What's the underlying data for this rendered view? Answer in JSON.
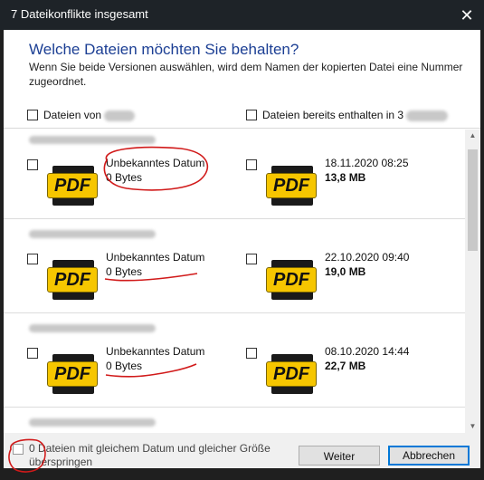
{
  "window": {
    "title": "7 Dateikonflikte insgesamt",
    "close_glyph": "✕"
  },
  "dialog": {
    "heading": "Welche Dateien möchten Sie behalten?",
    "description": "Wenn Sie beide Versionen auswählen, wird dem Namen der kopierten Datei eine Nummer zugeordnet.",
    "col_left": "Dateien von",
    "col_right": "Dateien bereits enthalten in 3"
  },
  "entries": [
    {
      "left_date": "Unbekanntes Datum",
      "left_size": "0 Bytes",
      "right_date": "18.11.2020 08:25",
      "right_size": "13,8 MB"
    },
    {
      "left_date": "Unbekanntes Datum",
      "left_size": "0 Bytes",
      "right_date": "22.10.2020 09:40",
      "right_size": "19,0 MB"
    },
    {
      "left_date": "Unbekanntes Datum",
      "left_size": "0 Bytes",
      "right_date": "08.10.2020 14:44",
      "right_size": "22,7 MB"
    }
  ],
  "icon_label": "PDF",
  "footer": {
    "skip_label": "0 Dateien mit gleichem Datum und gleicher Größe überspringen",
    "continue_label": "Weiter",
    "cancel_label": "Abbrechen"
  },
  "icons": {
    "file_icon": "pdf-file-icon",
    "close": "close-icon"
  },
  "colors": {
    "heading": "#1c3f94",
    "annotation": "#d11a1a",
    "pdf_yellow": "#f6c600",
    "default_button_border": "#0078d7"
  }
}
